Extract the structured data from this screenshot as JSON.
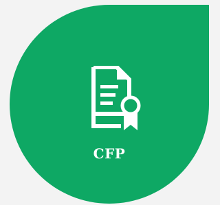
{
  "card": {
    "label": "CFP",
    "icon": "certificate-document-icon",
    "colors": {
      "background": "#f3f3f3",
      "tile": "#0ea864",
      "foreground": "#ffffff"
    }
  }
}
